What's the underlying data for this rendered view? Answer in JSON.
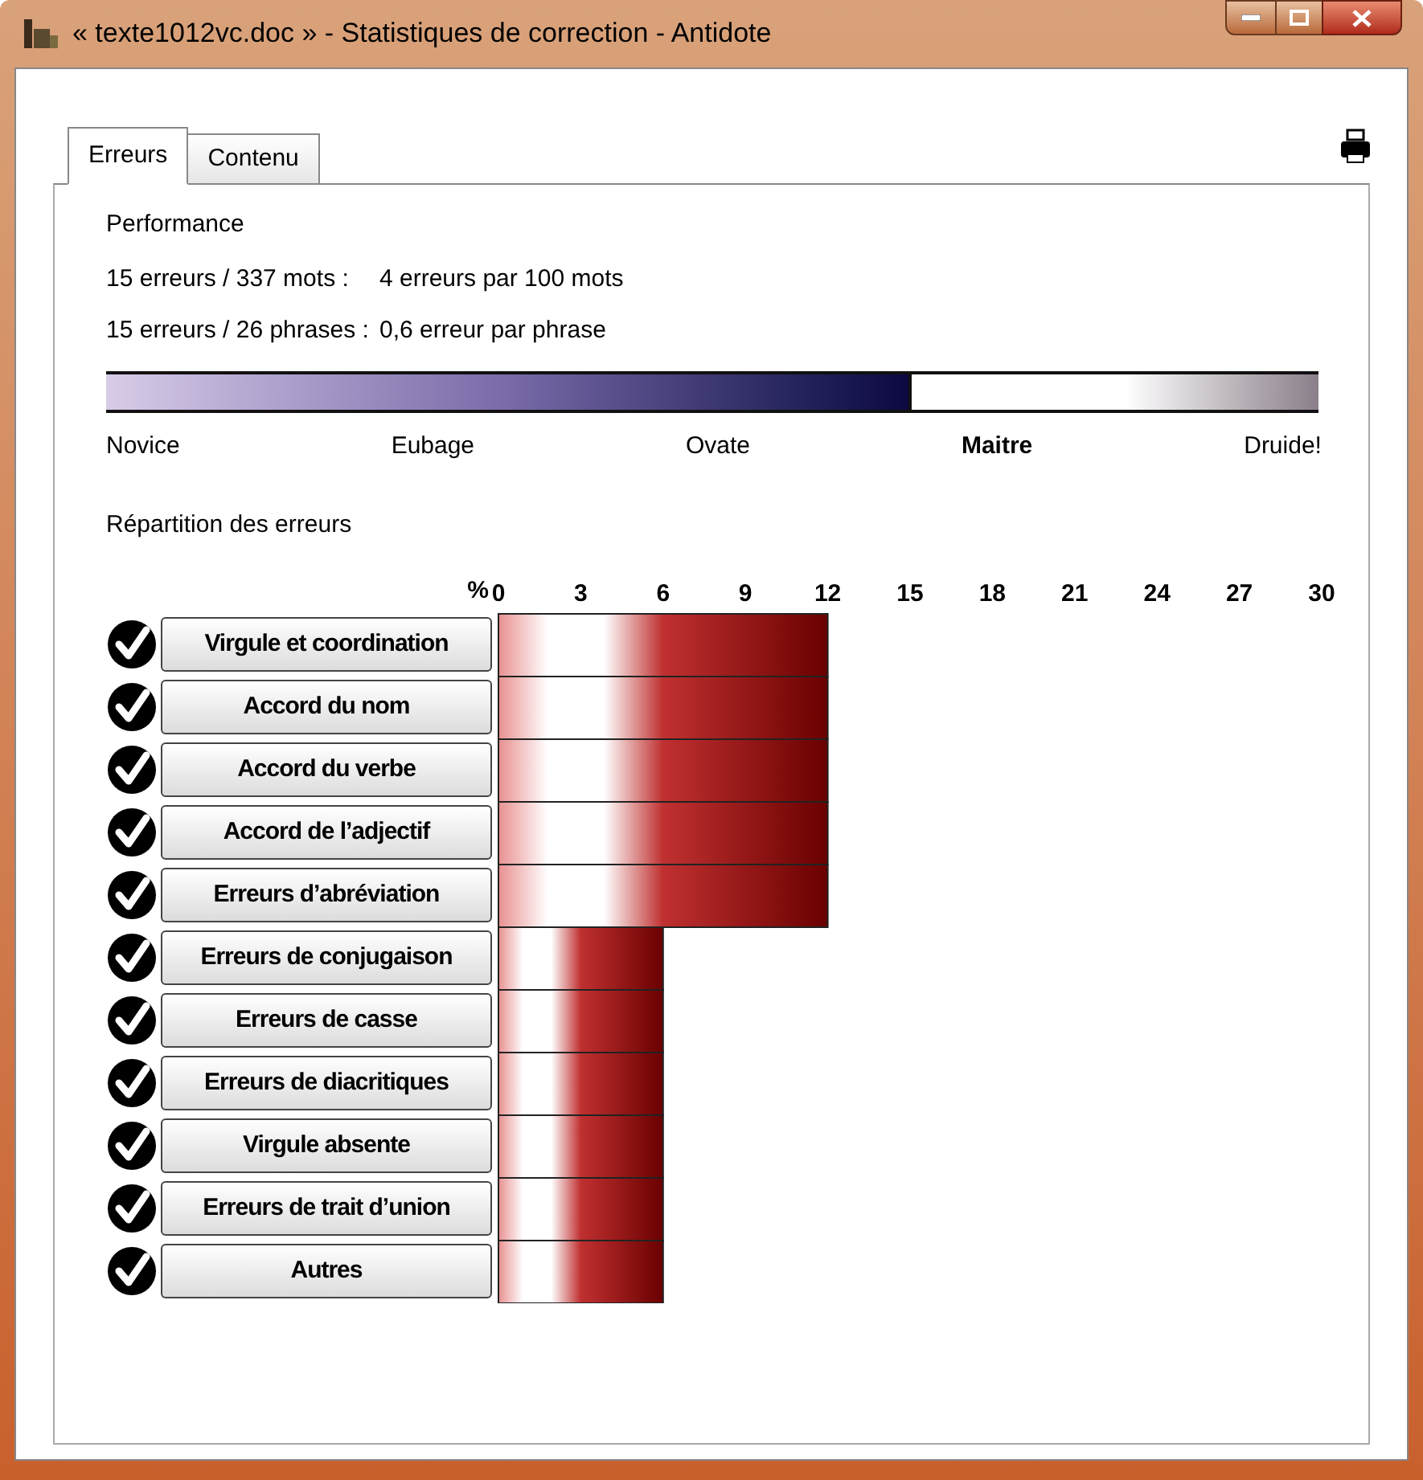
{
  "window": {
    "title": "« texte1012vc.doc » - Statistiques de correction - Antidote"
  },
  "tabs": [
    {
      "label": "Erreurs",
      "selected": true
    },
    {
      "label": "Contenu",
      "selected": false
    }
  ],
  "performance": {
    "heading": "Performance",
    "stats": [
      {
        "label": "15 erreurs / 337 mots :",
        "value": "4 erreurs par 100 mots"
      },
      {
        "label": "15 erreurs / 26 phrases :",
        "value": "0,6 erreur par phrase"
      }
    ],
    "level": 0.665,
    "ranks": [
      {
        "label": "Novice",
        "selected": false
      },
      {
        "label": "Eubage",
        "selected": false
      },
      {
        "label": "Ovate",
        "selected": false
      },
      {
        "label": "Maitre",
        "selected": true
      },
      {
        "label": "Druide!",
        "selected": false
      }
    ]
  },
  "distribution": {
    "heading": "Répartition des erreurs",
    "category_toggles": [
      {
        "checked": true
      },
      {
        "checked": true
      },
      {
        "checked": true
      },
      {
        "checked": true
      },
      {
        "checked": true
      },
      {
        "checked": true
      },
      {
        "checked": true
      },
      {
        "checked": true
      },
      {
        "checked": true
      },
      {
        "checked": true
      },
      {
        "checked": true
      }
    ],
    "chart_data": {
      "type": "bar",
      "orientation": "horizontal",
      "xlabel": "%",
      "categories": [
        "Virgule et coordination",
        "Accord du nom",
        "Accord du verbe",
        "Accord de l’adjectif",
        "Erreurs d’abréviation",
        "Erreurs de conjugaison",
        "Erreurs de casse",
        "Erreurs de diacritiques",
        "Virgule absente",
        "Erreurs de trait d’union",
        "Autres"
      ],
      "values": [
        12,
        12,
        12,
        12,
        12,
        6,
        6,
        6,
        6,
        6,
        6
      ],
      "xlim": [
        0,
        30
      ],
      "xticks": [
        {
          "value": 0,
          "label": "0"
        },
        {
          "value": 3,
          "label": "3"
        },
        {
          "value": 6,
          "label": "6"
        },
        {
          "value": 9,
          "label": "9"
        },
        {
          "value": 12,
          "label": "12"
        },
        {
          "value": 15,
          "label": "15"
        },
        {
          "value": 18,
          "label": "18"
        },
        {
          "value": 21,
          "label": "21"
        },
        {
          "value": 24,
          "label": "24"
        },
        {
          "value": 27,
          "label": "27"
        },
        {
          "value": 30,
          "label": "30"
        }
      ]
    }
  }
}
